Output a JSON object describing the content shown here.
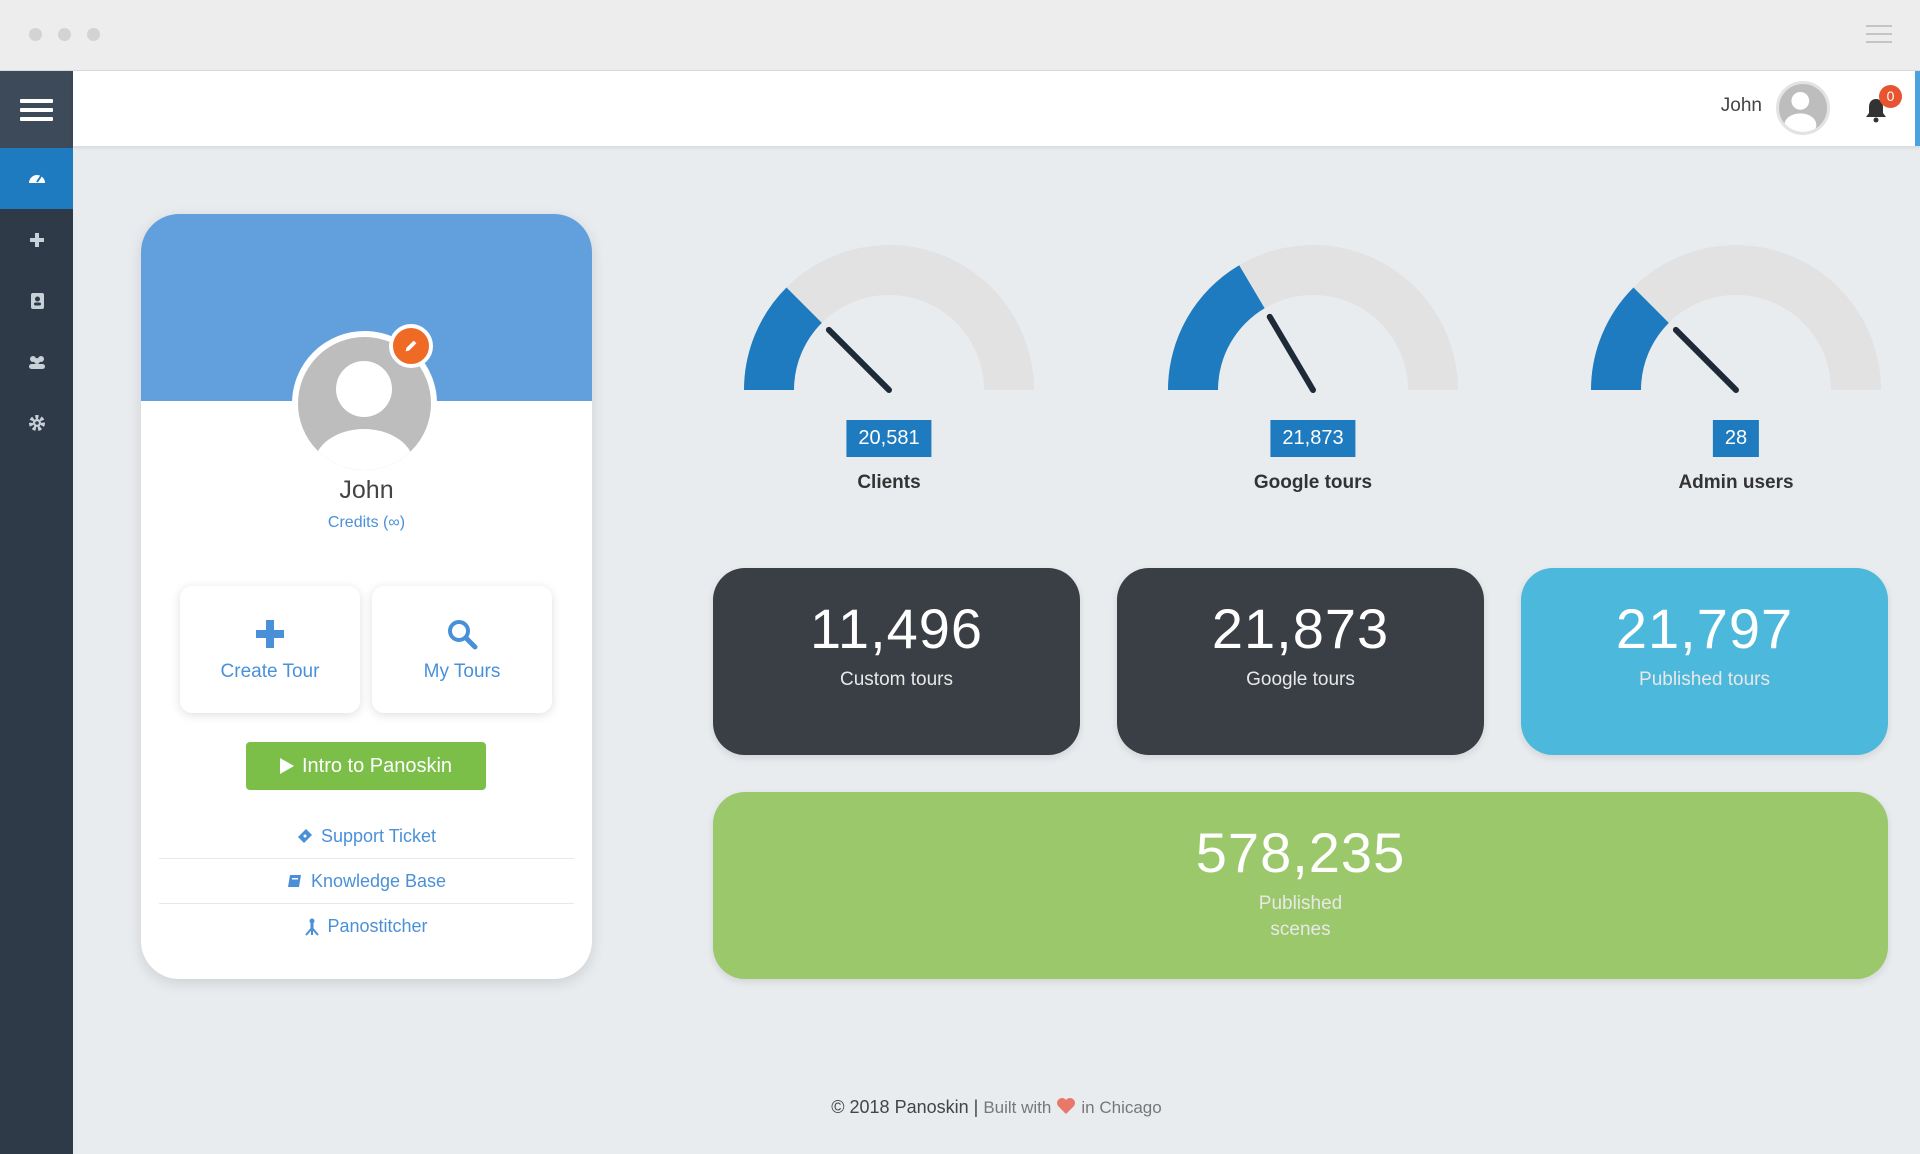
{
  "header": {
    "user_name": "John",
    "notification_count": "0"
  },
  "sidebar": {
    "items": [
      {
        "icon": "dashboard-icon",
        "active": true
      },
      {
        "icon": "plus-icon",
        "active": false
      },
      {
        "icon": "address-book-icon",
        "active": false
      },
      {
        "icon": "users-icon",
        "active": false
      },
      {
        "icon": "gear-icon",
        "active": false
      }
    ]
  },
  "profile": {
    "name": "John",
    "credits": "Credits (∞)",
    "create_tour_label": "Create Tour",
    "my_tours_label": "My Tours",
    "intro_label": "Intro to Panoskin",
    "links": {
      "support": "Support Ticket",
      "knowledge": "Knowledge Base",
      "panostitcher": "Panostitcher"
    }
  },
  "gauges": [
    {
      "value": "20,581",
      "label": "Clients",
      "fill_fraction": 0.25
    },
    {
      "value": "21,873",
      "label": "Google tours",
      "fill_fraction": 0.33
    },
    {
      "value": "28",
      "label": "Admin users",
      "fill_fraction": 0.25
    }
  ],
  "stats": {
    "custom": {
      "value": "11,496",
      "label": "Custom tours"
    },
    "google": {
      "value": "21,873",
      "label": "Google tours"
    },
    "published_tours": {
      "value": "21,797",
      "label": "Published tours"
    },
    "scenes": {
      "value": "578,235",
      "label": "Published scenes"
    }
  },
  "colors": {
    "sidebar": "#2e3a48",
    "accent_blue": "#1e7bbf",
    "card_dark": "#3a3e45",
    "card_cyan": "#4cb8dc",
    "card_green": "#9bc86a",
    "badge_red": "#e8542f"
  },
  "footer": {
    "copyright": "© 2018 Panoskin",
    "built_with": "Built with",
    "location": "in Chicago"
  }
}
